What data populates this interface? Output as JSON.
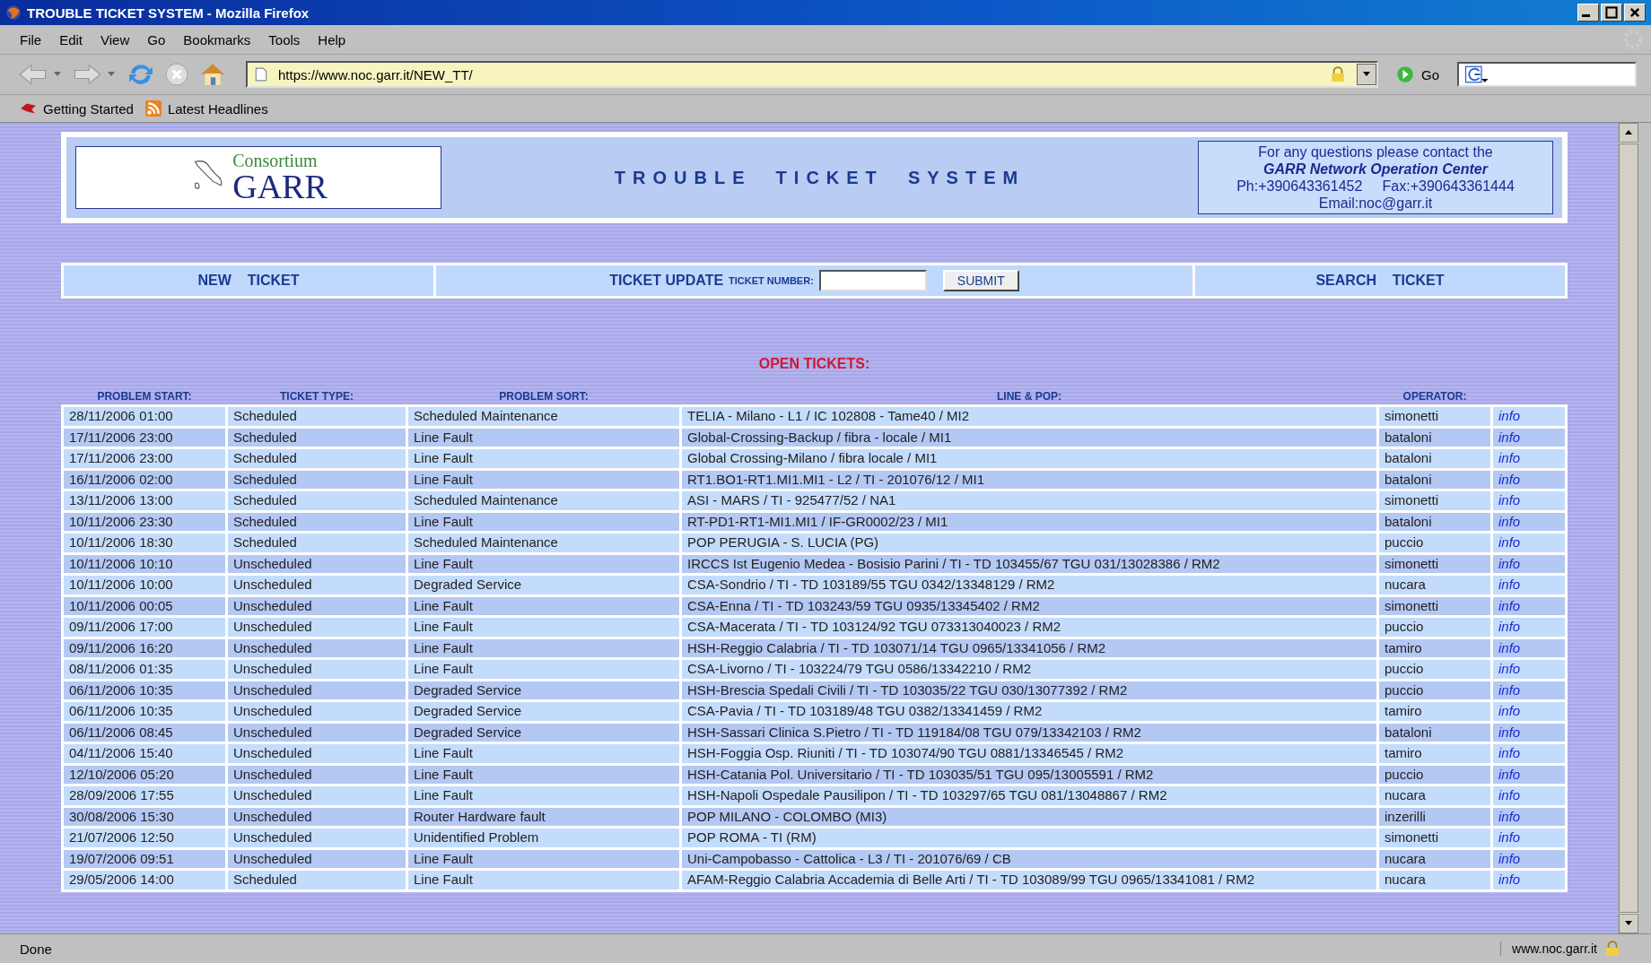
{
  "window": {
    "title": "TROUBLE TICKET SYSTEM - Mozilla Firefox"
  },
  "menu": [
    "File",
    "Edit",
    "View",
    "Go",
    "Bookmarks",
    "Tools",
    "Help"
  ],
  "toolbar": {
    "url": "https://www.noc.garr.it/NEW_TT/",
    "go": "Go"
  },
  "bookmarks": [
    "Getting Started",
    "Latest Headlines"
  ],
  "header": {
    "logo_top": "Consortium",
    "logo_bottom": "GARR",
    "title": "TROUBLE  TICKET  SYSTEM",
    "contact": [
      {
        "kind": "plain",
        "text": "For any questions please contact the"
      },
      {
        "kind": "strong",
        "text": "GARR Network Operation Center"
      },
      {
        "kind": "plain",
        "text": "Ph:+390643361452     Fax:+390643361444"
      },
      {
        "kind": "plain",
        "text": "Email:noc@garr.it"
      }
    ]
  },
  "nav": {
    "new_ticket": "NEW    TICKET",
    "update": "TICKET UPDATE",
    "number_label": "TICKET NUMBER:",
    "submit": "SUBMIT",
    "search_ticket": "SEARCH    TICKET"
  },
  "table": {
    "title": "OPEN TICKETS:",
    "columns": [
      "PROBLEM START:",
      "TICKET TYPE:",
      "PROBLEM SORT:",
      "LINE & POP:",
      "OPERATOR:"
    ],
    "rows": [
      [
        "28/11/2006 01:00",
        "Scheduled",
        "Scheduled Maintenance",
        "TELIA - Milano - L1 / IC 102808 - Tame40 / MI2",
        "simonetti",
        "info"
      ],
      [
        "17/11/2006 23:00",
        "Scheduled",
        "Line Fault",
        "Global-Crossing-Backup / fibra - locale / MI1",
        "bataloni",
        "info"
      ],
      [
        "17/11/2006 23:00",
        "Scheduled",
        "Line Fault",
        "Global Crossing-Milano / fibra locale / MI1",
        "bataloni",
        "info"
      ],
      [
        "16/11/2006 02:00",
        "Scheduled",
        "Line Fault",
        "RT1.BO1-RT1.MI1.MI1 - L2 / TI - 201076/12 / MI1",
        "bataloni",
        "info"
      ],
      [
        "13/11/2006 13:00",
        "Scheduled",
        "Scheduled Maintenance",
        "ASI - MARS / TI - 925477/52 / NA1",
        "simonetti",
        "info"
      ],
      [
        "10/11/2006 23:30",
        "Scheduled",
        "Line Fault",
        "RT-PD1-RT1-MI1.MI1 / IF-GR0002/23 / MI1",
        "bataloni",
        "info"
      ],
      [
        "10/11/2006 18:30",
        "Scheduled",
        "Scheduled Maintenance",
        "POP PERUGIA - S. LUCIA (PG)",
        "puccio",
        "info"
      ],
      [
        "10/11/2006 10:10",
        "Unscheduled",
        "Line Fault",
        "IRCCS Ist Eugenio Medea - Bosisio Parini / TI - TD 103455/67 TGU 031/13028386 / RM2",
        "simonetti",
        "info"
      ],
      [
        "10/11/2006 10:00",
        "Unscheduled",
        "Degraded Service",
        "CSA-Sondrio / TI - TD 103189/55 TGU 0342/13348129 / RM2",
        "nucara",
        "info"
      ],
      [
        "10/11/2006 00:05",
        "Unscheduled",
        "Line Fault",
        "CSA-Enna / TI - TD 103243/59 TGU 0935/13345402 / RM2",
        "simonetti",
        "info"
      ],
      [
        "09/11/2006 17:00",
        "Unscheduled",
        "Line Fault",
        "CSA-Macerata / TI - TD 103124/92 TGU 073313040023 / RM2",
        "puccio",
        "info"
      ],
      [
        "09/11/2006 16:20",
        "Unscheduled",
        "Line Fault",
        "HSH-Reggio Calabria / TI - TD 103071/14 TGU 0965/13341056 / RM2",
        "tamiro",
        "info"
      ],
      [
        "08/11/2006 01:35",
        "Unscheduled",
        "Line Fault",
        "CSA-Livorno / TI - 103224/79 TGU 0586/13342210 / RM2",
        "puccio",
        "info"
      ],
      [
        "06/11/2006 10:35",
        "Unscheduled",
        "Degraded Service",
        "HSH-Brescia Spedali Civili / TI - TD 103035/22 TGU 030/13077392 / RM2",
        "puccio",
        "info"
      ],
      [
        "06/11/2006 10:35",
        "Unscheduled",
        "Degraded Service",
        "CSA-Pavia / TI - TD 103189/48 TGU 0382/13341459 / RM2",
        "tamiro",
        "info"
      ],
      [
        "06/11/2006 08:45",
        "Unscheduled",
        "Degraded Service",
        "HSH-Sassari Clinica S.Pietro / TI - TD 119184/08 TGU 079/13342103 / RM2",
        "bataloni",
        "info"
      ],
      [
        "04/11/2006 15:40",
        "Unscheduled",
        "Line Fault",
        "HSH-Foggia Osp. Riuniti / TI - TD 103074/90 TGU 0881/13346545 / RM2",
        "tamiro",
        "info"
      ],
      [
        "12/10/2006 05:20",
        "Unscheduled",
        "Line Fault",
        "HSH-Catania Pol. Universitario / TI - TD 103035/51 TGU 095/13005591 / RM2",
        "puccio",
        "info"
      ],
      [
        "28/09/2006 17:55",
        "Unscheduled",
        "Line Fault",
        "HSH-Napoli Ospedale Pausilipon / TI - TD 103297/65 TGU 081/13048867 / RM2",
        "nucara",
        "info"
      ],
      [
        "30/08/2006 15:30",
        "Unscheduled",
        "Router Hardware fault",
        "POP MILANO - COLOMBO (MI3)",
        "inzerilli",
        "info"
      ],
      [
        "21/07/2006 12:50",
        "Unscheduled",
        "Unidentified Problem",
        "POP ROMA - TI (RM)",
        "simonetti",
        "info"
      ],
      [
        "19/07/2006 09:51",
        "Unscheduled",
        "Line Fault",
        "Uni-Campobasso - Cattolica - L3 / TI - 201076/69 / CB",
        "nucara",
        "info"
      ],
      [
        "29/05/2006 14:00",
        "Scheduled",
        "Line Fault",
        "AFAM-Reggio Calabria Accademia di Belle Arti / TI - TD 103089/99 TGU 0965/13341081 / RM2",
        "nucara",
        "info"
      ]
    ]
  },
  "status_bar": {
    "text": "Done",
    "host": "www.noc.garr.it"
  }
}
